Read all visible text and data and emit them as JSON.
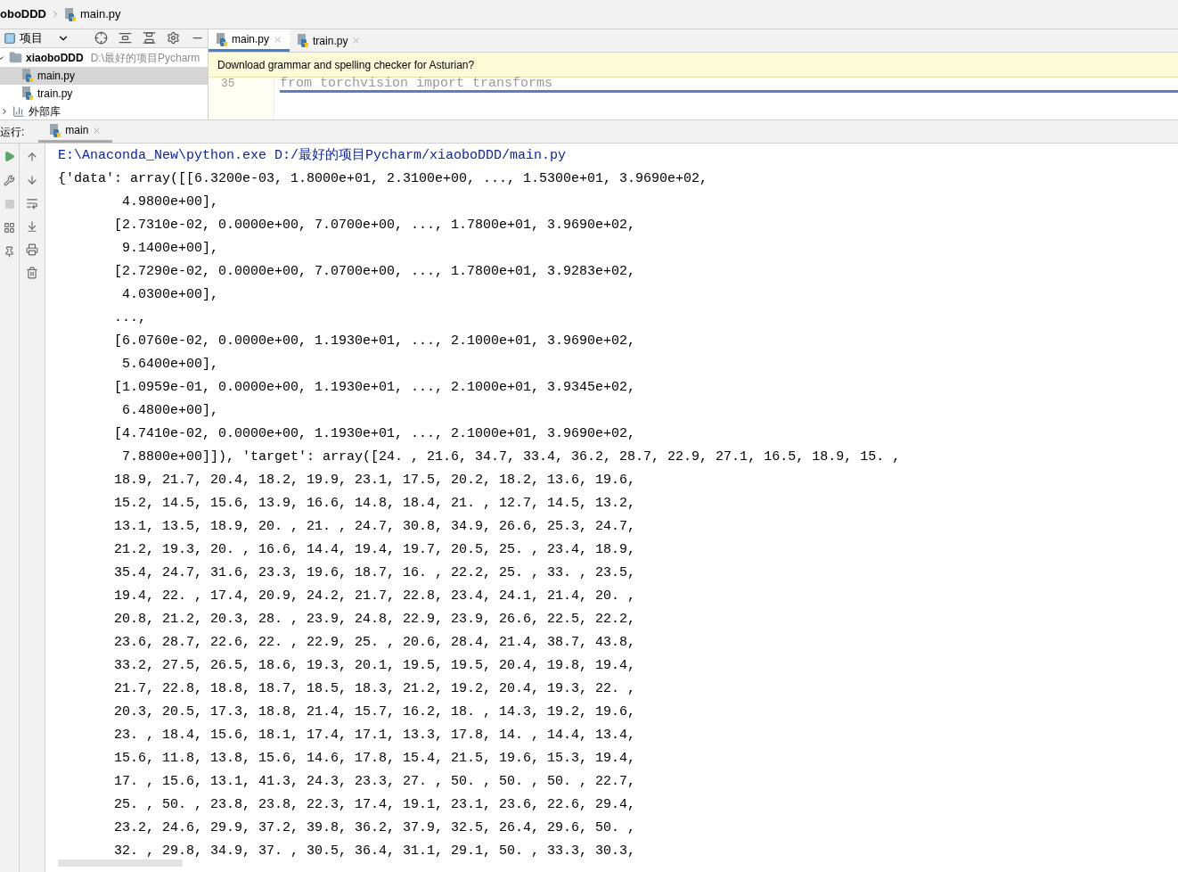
{
  "breadcrumb": [
    {
      "label": "oboDDD",
      "kind": "folder"
    },
    {
      "label": "main.py",
      "kind": "file"
    }
  ],
  "project_panel": {
    "title": "项目",
    "tree": [
      {
        "label": "xiaoboDDD",
        "path": "D:\\最好的项目Pycharm",
        "kind": "folder",
        "expanded": true,
        "selected": false,
        "children": [
          {
            "label": "main.py",
            "kind": "file",
            "selected": true
          },
          {
            "label": "train.py",
            "kind": "file",
            "selected": false
          }
        ]
      },
      {
        "label": "外部库",
        "kind": "library",
        "expanded": false,
        "selected": false
      }
    ]
  },
  "editor": {
    "tabs": [
      {
        "label": "main.py",
        "selected": true
      },
      {
        "label": "train.py",
        "selected": false
      }
    ],
    "notification": "Download grammar and spelling checker for Asturian?",
    "line_number": "35",
    "code": "from torchvision import transforms"
  },
  "run_panel": {
    "label": "运行:",
    "tabs": [
      {
        "label": "main",
        "selected": true
      }
    ]
  },
  "console": [
    {
      "kind": "command",
      "text": "E:\\Anaconda_New\\python.exe D:/最好的项目Pycharm/xiaoboDDD/main.py"
    },
    {
      "kind": "output",
      "text": "{'data': array([[6.3200e-03, 1.8000e+01, 2.3100e+00, ..., 1.5300e+01, 3.9690e+02,"
    },
    {
      "kind": "output",
      "text": "        4.9800e+00],"
    },
    {
      "kind": "output",
      "text": "       [2.7310e-02, 0.0000e+00, 7.0700e+00, ..., 1.7800e+01, 3.9690e+02,"
    },
    {
      "kind": "output",
      "text": "        9.1400e+00],"
    },
    {
      "kind": "output",
      "text": "       [2.7290e-02, 0.0000e+00, 7.0700e+00, ..., 1.7800e+01, 3.9283e+02,"
    },
    {
      "kind": "output",
      "text": "        4.0300e+00],"
    },
    {
      "kind": "output",
      "text": "       ...,"
    },
    {
      "kind": "output",
      "text": "       [6.0760e-02, 0.0000e+00, 1.1930e+01, ..., 2.1000e+01, 3.9690e+02,"
    },
    {
      "kind": "output",
      "text": "        5.6400e+00],"
    },
    {
      "kind": "output",
      "text": "       [1.0959e-01, 0.0000e+00, 1.1930e+01, ..., 2.1000e+01, 3.9345e+02,"
    },
    {
      "kind": "output",
      "text": "        6.4800e+00],"
    },
    {
      "kind": "output",
      "text": "       [4.7410e-02, 0.0000e+00, 1.1930e+01, ..., 2.1000e+01, 3.9690e+02,"
    },
    {
      "kind": "output",
      "text": "        7.8800e+00]]), 'target': array([24. , 21.6, 34.7, 33.4, 36.2, 28.7, 22.9, 27.1, 16.5, 18.9, 15. ,"
    },
    {
      "kind": "output",
      "text": "       18.9, 21.7, 20.4, 18.2, 19.9, 23.1, 17.5, 20.2, 18.2, 13.6, 19.6,"
    },
    {
      "kind": "output",
      "text": "       15.2, 14.5, 15.6, 13.9, 16.6, 14.8, 18.4, 21. , 12.7, 14.5, 13.2,"
    },
    {
      "kind": "output",
      "text": "       13.1, 13.5, 18.9, 20. , 21. , 24.7, 30.8, 34.9, 26.6, 25.3, 24.7,"
    },
    {
      "kind": "output",
      "text": "       21.2, 19.3, 20. , 16.6, 14.4, 19.4, 19.7, 20.5, 25. , 23.4, 18.9,"
    },
    {
      "kind": "output",
      "text": "       35.4, 24.7, 31.6, 23.3, 19.6, 18.7, 16. , 22.2, 25. , 33. , 23.5,"
    },
    {
      "kind": "output",
      "text": "       19.4, 22. , 17.4, 20.9, 24.2, 21.7, 22.8, 23.4, 24.1, 21.4, 20. ,"
    },
    {
      "kind": "output",
      "text": "       20.8, 21.2, 20.3, 28. , 23.9, 24.8, 22.9, 23.9, 26.6, 22.5, 22.2,"
    },
    {
      "kind": "output",
      "text": "       23.6, 28.7, 22.6, 22. , 22.9, 25. , 20.6, 28.4, 21.4, 38.7, 43.8,"
    },
    {
      "kind": "output",
      "text": "       33.2, 27.5, 26.5, 18.6, 19.3, 20.1, 19.5, 19.5, 20.4, 19.8, 19.4,"
    },
    {
      "kind": "output",
      "text": "       21.7, 22.8, 18.8, 18.7, 18.5, 18.3, 21.2, 19.2, 20.4, 19.3, 22. ,"
    },
    {
      "kind": "output",
      "text": "       20.3, 20.5, 17.3, 18.8, 21.4, 15.7, 16.2, 18. , 14.3, 19.2, 19.6,"
    },
    {
      "kind": "output",
      "text": "       23. , 18.4, 15.6, 18.1, 17.4, 17.1, 13.3, 17.8, 14. , 14.4, 13.4,"
    },
    {
      "kind": "output",
      "text": "       15.6, 11.8, 13.8, 15.6, 14.6, 17.8, 15.4, 21.5, 19.6, 15.3, 19.4,"
    },
    {
      "kind": "output",
      "text": "       17. , 15.6, 13.1, 41.3, 24.3, 23.3, 27. , 50. , 50. , 50. , 22.7,"
    },
    {
      "kind": "output",
      "text": "       25. , 50. , 23.8, 23.8, 22.3, 17.4, 19.1, 23.1, 23.6, 22.6, 29.4,"
    },
    {
      "kind": "output",
      "text": "       23.2, 24.6, 29.9, 37.2, 39.8, 36.2, 37.9, 32.5, 26.4, 29.6, 50. ,"
    },
    {
      "kind": "output",
      "text": "       32. , 29.8, 34.9, 37. , 30.5, 36.4, 31.1, 29.1, 50. , 33.3, 30.3,"
    }
  ]
}
